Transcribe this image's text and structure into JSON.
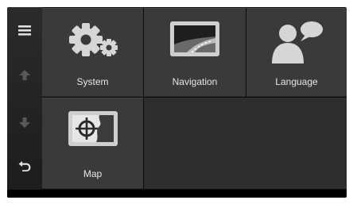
{
  "sidebar": {
    "menu_icon": "menu-icon",
    "up_icon": "arrow-up-icon",
    "down_icon": "arrow-down-icon",
    "back_icon": "back-icon"
  },
  "tiles": [
    {
      "label": "System",
      "icon": "gears-icon"
    },
    {
      "label": "Navigation",
      "icon": "road-icon"
    },
    {
      "label": "Language",
      "icon": "speaker-icon"
    },
    {
      "label": "Map",
      "icon": "map-target-icon"
    }
  ],
  "colors": {
    "tile": "#3a3a3a",
    "sidebar": "#222222",
    "icon": "#d8d8d8",
    "disabled_icon": "#5a5a5a"
  }
}
